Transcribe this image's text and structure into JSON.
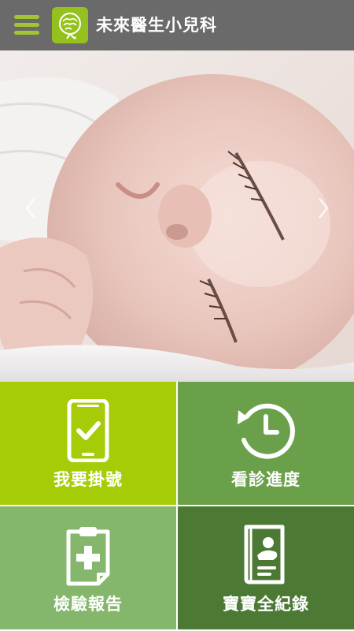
{
  "app": {
    "title": "未來醫生小兒科",
    "menu_icon": "hamburger-menu-icon",
    "logo_icon": "clinic-logo-icon",
    "colors": {
      "topbar": "#6a6a6a",
      "menu_accent": "#a3c630",
      "logo_bg": "#95c11f"
    }
  },
  "carousel": {
    "image": "sleeping-baby-photo",
    "prev_icon": "chevron-left-icon",
    "next_icon": "chevron-right-icon"
  },
  "tiles": [
    {
      "label": "我要掛號",
      "icon": "phone-check-icon",
      "color": "#a6cc07"
    },
    {
      "label": "看診進度",
      "icon": "history-clock-icon",
      "color": "#6ba04a"
    },
    {
      "label": "檢驗報告",
      "icon": "clipboard-medical-icon",
      "color": "#84b66c"
    },
    {
      "label": "寶寶全紀錄",
      "icon": "baby-record-icon",
      "color": "#4c7a35"
    }
  ]
}
